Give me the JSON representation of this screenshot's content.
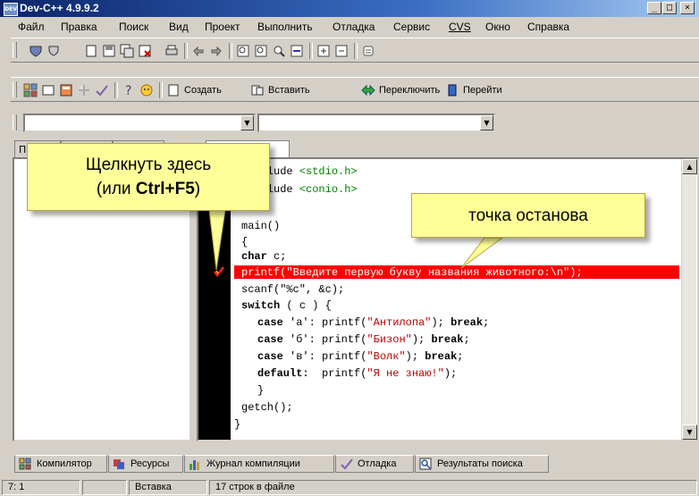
{
  "window": {
    "title": "Dev-C++ 4.9.9.2",
    "app_icon_text": "DEV",
    "caption_buttons": {
      "minimize": "_",
      "maximize": "□",
      "close": "×"
    }
  },
  "menu": [
    "Файл",
    "Правка",
    "Поиск",
    "Вид",
    "Проект",
    "Выполнить",
    "Отладка",
    "Сервис",
    "CVS",
    "Окно",
    "Справка"
  ],
  "toolbar2": {
    "create_label": "Создать",
    "insert_label": "Вставить",
    "toggle_label": "Переключить",
    "goto_label": "Перейти"
  },
  "left_tabs": [
    "Пр",
    "",
    ""
  ],
  "code_lines": [
    {
      "text": "#include <stdio.h>",
      "type": "include"
    },
    {
      "text": "#include <conio.h>",
      "type": "include"
    },
    {
      "text": "",
      "type": "blank"
    },
    {
      "text": "main()",
      "type": "plain"
    },
    {
      "text": "{",
      "type": "plain"
    }
  ],
  "code": {
    "inc1_head": "#include ",
    "inc1_tail": "<stdio.h>",
    "inc2_head": "#include ",
    "inc2_tail": "<conio.h>",
    "main": "main()",
    "open_brace": "{",
    "char_kw": "char",
    "char_rest": " c;",
    "printf_bp": "printf(\"Введите первую букву названия животного:\\n\");",
    "scanf": "scanf(\"%c\", &c);",
    "switch_kw": "switch",
    "switch_rest": " ( c ) {",
    "case_kw": "case",
    "case1_mid": " 'а': printf(",
    "case1_str": "\"Антилопа\"",
    "case2_mid": " 'б': printf(",
    "case2_str": "\"Бизон\"",
    "case3_mid": " 'в': printf(",
    "case3_str": "\"Волк\"",
    "break_kw": "break",
    "default_kw": "default:",
    "default_mid": "  printf(",
    "default_str": "\"Я не знаю!\"",
    "close_inner": "}",
    "getch": "getch();",
    "close_outer": "}"
  },
  "bottom_tabs": [
    "Компилятор",
    "Ресурсы",
    "Журнал компиляции",
    "Отладка",
    "Результаты поиска"
  ],
  "status": {
    "position": "7: 1",
    "empty": "",
    "mode": "Вставка",
    "info": "17 строк в файле"
  },
  "callouts": {
    "click_here_line1": "Щелкнуть здесь",
    "click_here_line2a": "(или ",
    "click_here_hotkey": "Ctrl+F5",
    "click_here_line2b": ")",
    "breakpoint": "точка останова"
  },
  "colors": {
    "breakpoint_line": "#ff0000",
    "callout_fill": "#ffff99",
    "string_color": "#c00000",
    "include_color": "#008000",
    "titlebar": "#0a246a"
  }
}
